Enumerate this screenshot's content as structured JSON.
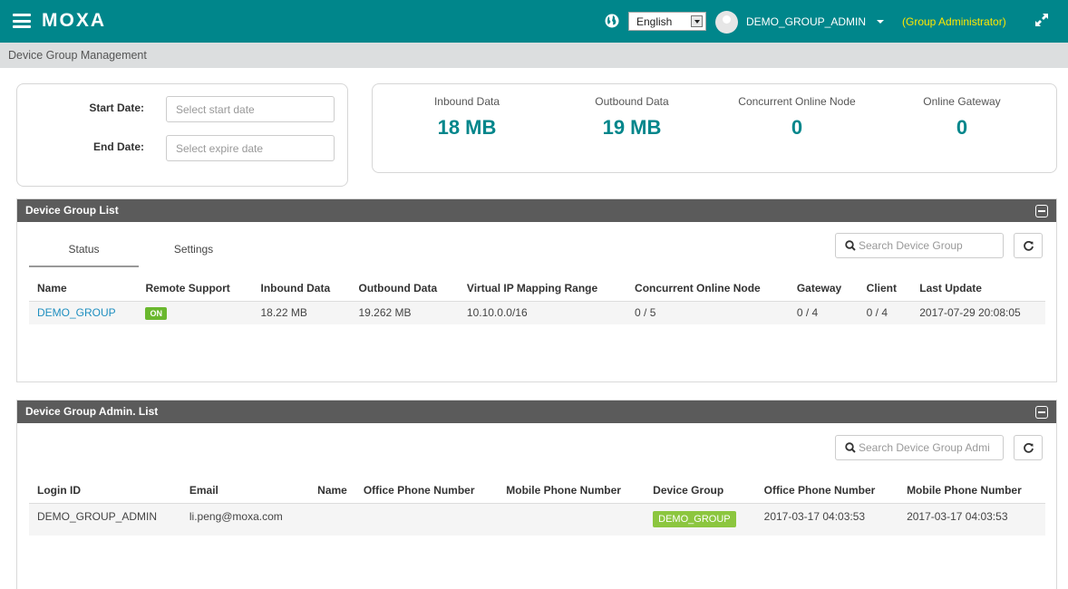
{
  "header": {
    "logo": "MOXA",
    "language": "English",
    "user_name": "DEMO_GROUP_ADMIN",
    "role": "(Group Administrator)"
  },
  "breadcrumb": "Device Group Management",
  "date_filter": {
    "start_label": "Start Date:",
    "start_placeholder": "Select start date",
    "end_label": "End Date:",
    "end_placeholder": "Select expire date"
  },
  "stats": [
    {
      "label": "Inbound Data",
      "value": "18 MB"
    },
    {
      "label": "Outbound Data",
      "value": "19 MB"
    },
    {
      "label": "Concurrent Online Node",
      "value": "0"
    },
    {
      "label": "Online Gateway",
      "value": "0"
    }
  ],
  "group_list": {
    "title": "Device Group List",
    "tabs": [
      "Status",
      "Settings"
    ],
    "search_placeholder": "Search Device Group",
    "columns": [
      "Name",
      "Remote Support",
      "Inbound Data",
      "Outbound Data",
      "Virtual IP Mapping Range",
      "Concurrent Online Node",
      "Gateway",
      "Client",
      "Last Update"
    ],
    "rows": [
      {
        "name": "DEMO_GROUP",
        "remote_support": "ON",
        "inbound": "18.22 MB",
        "outbound": "19.262 MB",
        "vip_range": "10.10.0.0/16",
        "online_node": "0 / 5",
        "gateway": "0 / 4",
        "client": "0 / 4",
        "last_update": "2017-07-29 20:08:05"
      }
    ]
  },
  "admin_list": {
    "title": "Device Group Admin. List",
    "search_placeholder": "Search Device Group Admi",
    "columns": [
      "Login ID",
      "Email",
      "Name",
      "Office Phone Number",
      "Mobile Phone Number",
      "Device Group",
      "Office Phone Number",
      "Mobile Phone Number"
    ],
    "rows": [
      {
        "login_id": "DEMO_GROUP_ADMIN",
        "email": "li.peng@moxa.com",
        "name": "",
        "office_phone": "",
        "mobile_phone": "",
        "device_group": "DEMO_GROUP",
        "office_phone_2": "2017-03-17 04:03:53",
        "mobile_phone_2": "2017-03-17 04:03:53"
      }
    ]
  },
  "colors": {
    "brand": "#00868b",
    "role": "#ffe800",
    "status_on": "#6ab82e",
    "link": "#1f8fc0"
  }
}
